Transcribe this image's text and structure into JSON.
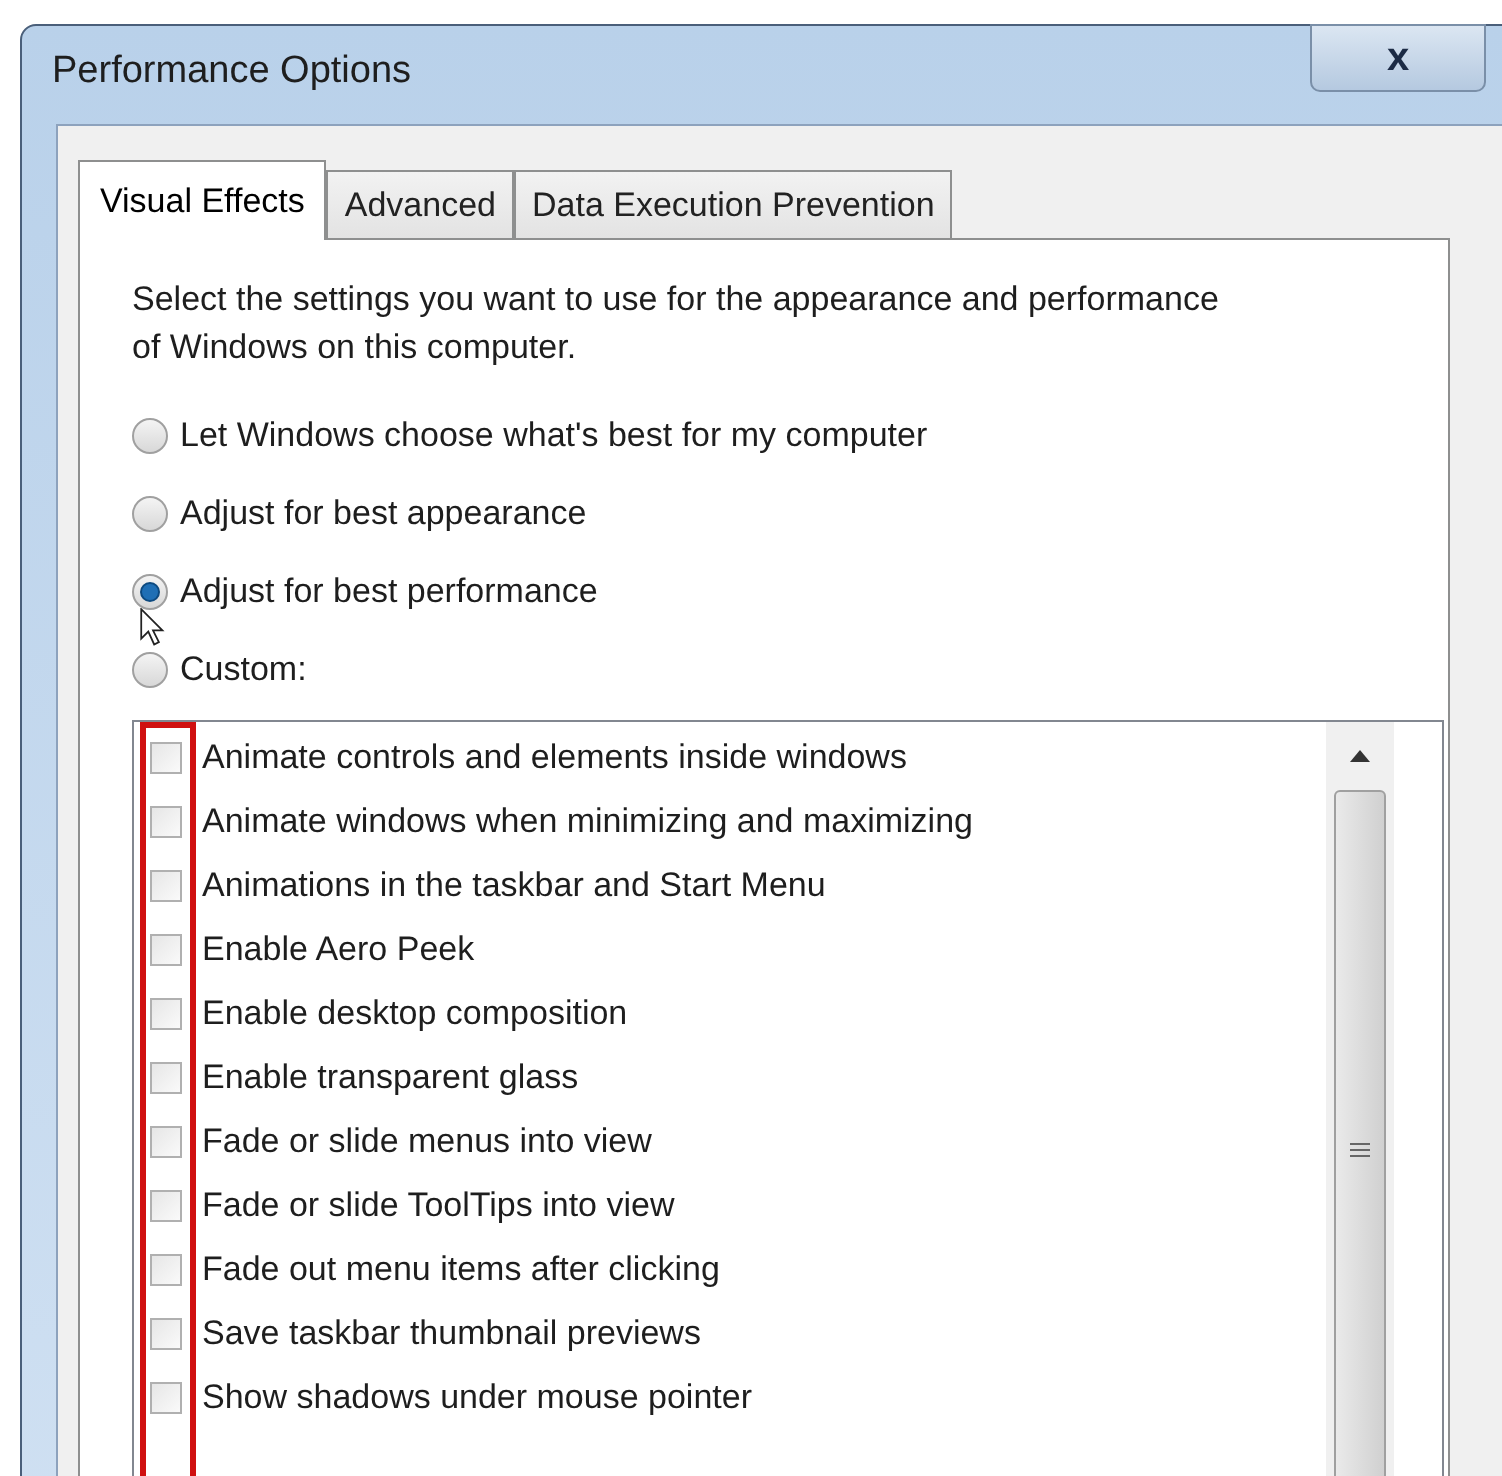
{
  "window": {
    "title": "Performance Options",
    "close": "x"
  },
  "tabs": [
    {
      "label": "Visual Effects",
      "selected": true
    },
    {
      "label": "Advanced",
      "selected": false
    },
    {
      "label": "Data Execution Prevention",
      "selected": false
    }
  ],
  "description": "Select the settings you want to use for the appearance and performance of Windows on this computer.",
  "options": [
    {
      "label": "Let Windows choose what's best for my computer",
      "selected": false
    },
    {
      "label": "Adjust for best appearance",
      "selected": false
    },
    {
      "label": "Adjust for best performance",
      "selected": true
    },
    {
      "label": "Custom:",
      "selected": false
    }
  ],
  "effects": [
    {
      "label": "Animate controls and elements inside windows",
      "checked": false
    },
    {
      "label": "Animate windows when minimizing and maximizing",
      "checked": false
    },
    {
      "label": "Animations in the taskbar and Start Menu",
      "checked": false
    },
    {
      "label": "Enable Aero Peek",
      "checked": false
    },
    {
      "label": "Enable desktop composition",
      "checked": false
    },
    {
      "label": "Enable transparent glass",
      "checked": false
    },
    {
      "label": "Fade or slide menus into view",
      "checked": false
    },
    {
      "label": "Fade or slide ToolTips into view",
      "checked": false
    },
    {
      "label": "Fade out menu items after clicking",
      "checked": false
    },
    {
      "label": "Save taskbar thumbnail previews",
      "checked": false
    },
    {
      "label": "Show shadows under mouse pointer",
      "checked": false
    }
  ]
}
